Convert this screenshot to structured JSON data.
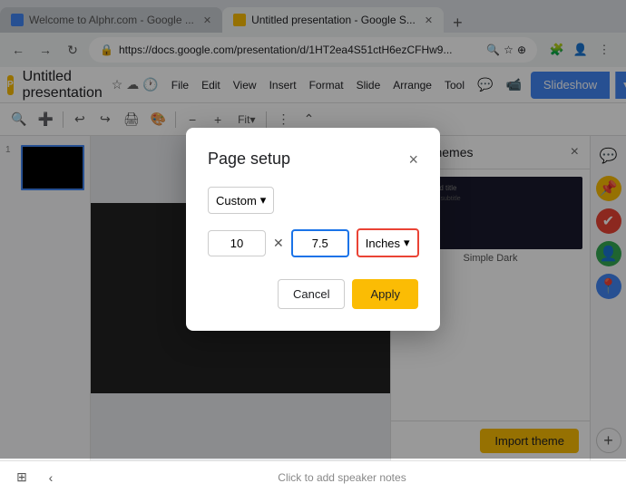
{
  "browser": {
    "tabs": [
      {
        "id": "tab1",
        "label": "Welcome to Alphr.com - Google ...",
        "favicon_color": "blue",
        "active": false
      },
      {
        "id": "tab2",
        "label": "Untitled presentation - Google S...",
        "favicon_color": "yellow",
        "active": true
      }
    ],
    "new_tab_label": "+",
    "url": "https://docs.google.com/presentation/d/1HT2ea4S51ctH6ezCFHw9...",
    "nav": {
      "back": "←",
      "forward": "→",
      "refresh": "↻"
    }
  },
  "app": {
    "logo_letter": "P",
    "title": "Untitled presentation",
    "menu_items": [
      "File",
      "Edit",
      "View",
      "Insert",
      "Format",
      "Slide",
      "Arrange",
      "Tool"
    ],
    "slideshow_label": "Slideshow",
    "toolbar": {
      "zoom_label": "Fit",
      "more_options": "⋮"
    }
  },
  "themes_panel": {
    "title": "Themes",
    "close_label": "×",
    "theme_name": "Simple Dark",
    "import_button_label": "Import theme"
  },
  "modal": {
    "title": "Page setup",
    "close_label": "×",
    "preset_label": "Custom",
    "width_value": "10",
    "height_value": "7.5",
    "unit_label": "Inches",
    "cancel_label": "Cancel",
    "apply_label": "Apply"
  },
  "bottom_bar": {
    "notes_placeholder": "Click to add speaker notes"
  }
}
